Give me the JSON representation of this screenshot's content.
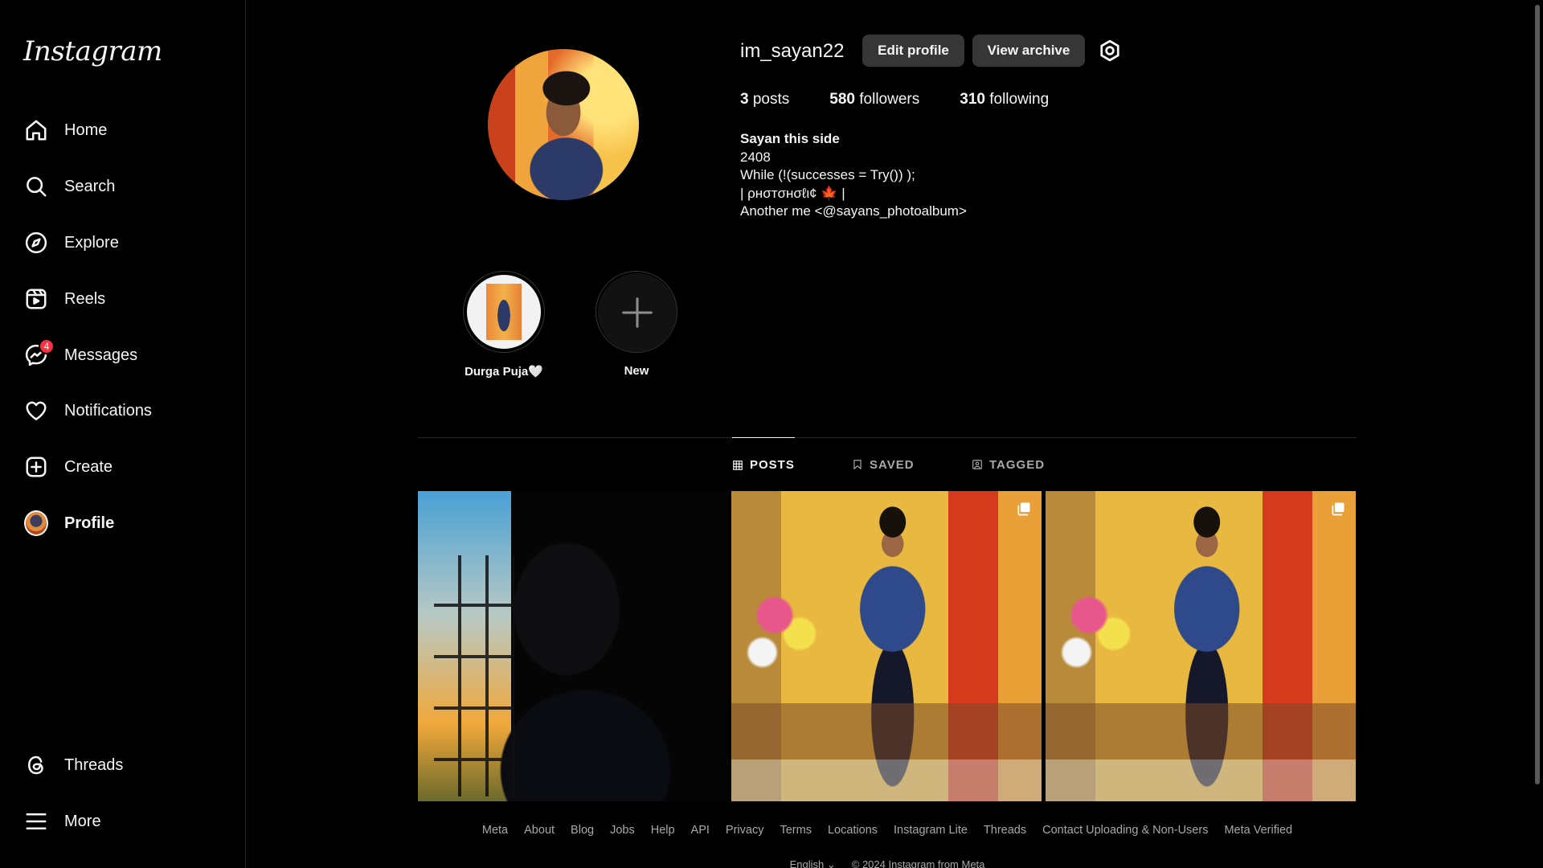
{
  "sidebar": {
    "logo": "Instagram",
    "items": [
      {
        "label": "Home",
        "icon": "home-icon"
      },
      {
        "label": "Search",
        "icon": "search-icon"
      },
      {
        "label": "Explore",
        "icon": "compass-icon"
      },
      {
        "label": "Reels",
        "icon": "reels-icon"
      },
      {
        "label": "Messages",
        "icon": "messenger-icon",
        "badge": "4"
      },
      {
        "label": "Notifications",
        "icon": "heart-icon"
      },
      {
        "label": "Create",
        "icon": "plus-square-icon"
      },
      {
        "label": "Profile",
        "icon": "avatar"
      },
      {
        "label": "Threads",
        "icon": "threads-icon"
      },
      {
        "label": "More",
        "icon": "hamburger-icon"
      }
    ]
  },
  "profile": {
    "username": "im_sayan22",
    "edit_label": "Edit profile",
    "archive_label": "View archive",
    "stats": {
      "posts_count": "3",
      "posts_label": "posts",
      "followers_count": "580",
      "followers_label": "followers",
      "following_count": "310",
      "following_label": "following"
    },
    "bio": {
      "name": "Sayan this side",
      "lines": [
        "2408",
        "While (!(successes = Try()) );",
        "| ρнσтσнσℓι¢ 🍁 |",
        "Another me <@sayans_photoalbum>"
      ]
    }
  },
  "highlights": [
    {
      "label": "Durga Puja🤍"
    },
    {
      "label": "New"
    }
  ],
  "tabs": [
    {
      "label": "POSTS",
      "icon": "grid-icon",
      "active": true
    },
    {
      "label": "SAVED",
      "icon": "bookmark-icon",
      "active": false
    },
    {
      "label": "TAGGED",
      "icon": "tagged-icon",
      "active": false
    }
  ],
  "posts": [
    {
      "multi": false
    },
    {
      "multi": true
    },
    {
      "multi": true
    }
  ],
  "footer": {
    "links": [
      "Meta",
      "About",
      "Blog",
      "Jobs",
      "Help",
      "API",
      "Privacy",
      "Terms",
      "Locations",
      "Instagram Lite",
      "Threads",
      "Contact Uploading & Non-Users",
      "Meta Verified"
    ],
    "language": "English ⌄",
    "copyright": "© 2024 Instagram from Meta"
  },
  "colors": {
    "background": "#000000",
    "text": "#f5f5f5",
    "muted": "#a8a8a8",
    "button": "#363636",
    "badge": "#ff3040"
  }
}
